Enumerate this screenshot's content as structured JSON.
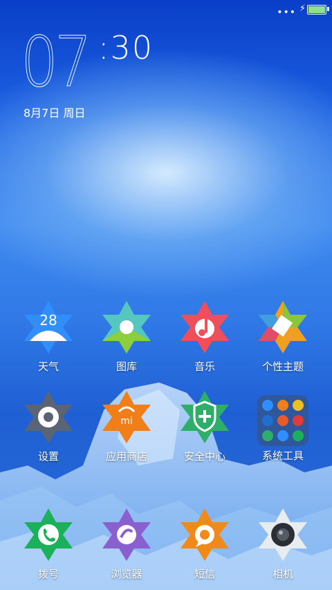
{
  "status_bar": {
    "signal_dots": "•••",
    "charging_icon": "bolt",
    "battery_level": 1.0,
    "battery_color": "#8ee08a"
  },
  "clock": {
    "hour": "07",
    "minute": ":30",
    "date": "8月7日 周日"
  },
  "apps": [
    {
      "label": "天气",
      "icon": "weather-icon",
      "badge": "28",
      "color": "#2f8fff"
    },
    {
      "label": "图库",
      "icon": "gallery-icon",
      "color": "#56c7c0"
    },
    {
      "label": "音乐",
      "icon": "music-icon",
      "color": "#ef4f5a"
    },
    {
      "label": "个性主题",
      "icon": "theme-icon",
      "color": "#f0a020"
    },
    {
      "label": "设置",
      "icon": "settings-icon",
      "color": "#5a6475"
    },
    {
      "label": "应用商店",
      "icon": "app-store-icon",
      "badge": "mi",
      "color": "#f07f1a"
    },
    {
      "label": "安全中心",
      "icon": "security-icon",
      "color": "#2fae6a"
    },
    {
      "label": "系统工具",
      "icon": "system-tools-folder",
      "color": "#3c506e"
    },
    {
      "label": "拨号",
      "icon": "phone-icon",
      "color": "#1bb15a"
    },
    {
      "label": "浏览器",
      "icon": "browser-icon",
      "color": "#8a5fd0"
    },
    {
      "label": "短信",
      "icon": "messages-icon",
      "color": "#f08a1a"
    },
    {
      "label": "相机",
      "icon": "camera-icon",
      "color": "#e8ecef"
    }
  ]
}
